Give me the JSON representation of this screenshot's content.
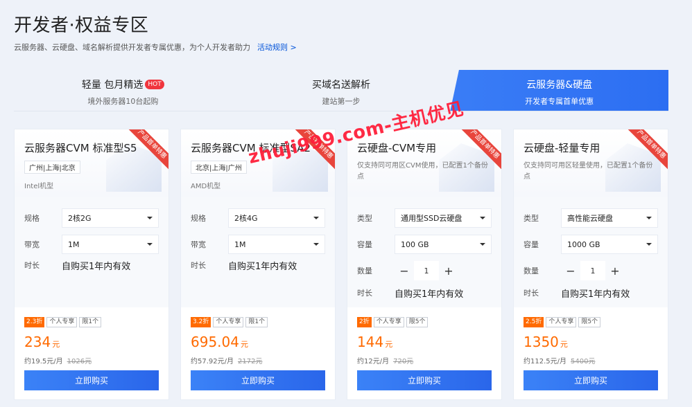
{
  "header": {
    "title": "开发者·权益专区",
    "subtitle": "云服务器、云硬盘、域名解析提供开发者专属优惠，为个人开发者助力",
    "rules_link": "活动规则 >"
  },
  "tabs": [
    {
      "title": "轻量 包月精选",
      "badge": "HOT",
      "sub": "境外服务器10台起购"
    },
    {
      "title": "买域名送解析",
      "sub": "建站第一步"
    },
    {
      "title": "云服务器&硬盘",
      "sub": "开发者专属首单优惠",
      "active": true
    }
  ],
  "ribbon_text": "产品首单特惠",
  "cards": [
    {
      "title": "云服务器CVM 标准型S5",
      "region": "广州|上海|北京",
      "desc": "Intel机型",
      "rows": [
        {
          "label": "规格",
          "value": "2核2G"
        },
        {
          "label": "带宽",
          "value": "1M"
        },
        {
          "label": "时长",
          "value": "自购买1年内有效"
        }
      ],
      "discount": "2.3折",
      "tags": [
        "个人专享",
        "限1个"
      ],
      "price": "234",
      "price_unit": "元",
      "monthly": "约19.5元/月",
      "original": "1026元",
      "buy_label": "立即购买"
    },
    {
      "title": "云服务器CVM 标准型SA2",
      "region": "北京|上海|广州",
      "desc": "AMD机型",
      "rows": [
        {
          "label": "规格",
          "value": "2核4G"
        },
        {
          "label": "带宽",
          "value": "1M"
        },
        {
          "label": "时长",
          "value": "自购买1年内有效"
        }
      ],
      "discount": "3.2折",
      "tags": [
        "个人专享",
        "限1个"
      ],
      "price": "695.04",
      "price_unit": "元",
      "monthly": "约57.92元/月",
      "original": "2172元",
      "buy_label": "立即购买"
    },
    {
      "title": "云硬盘-CVM专用",
      "desc": "仅支持同可用区CVM使用，已配置1个备份点",
      "rows": [
        {
          "label": "类型",
          "value": "通用型SSD云硬盘"
        },
        {
          "label": "容量",
          "value": "100 GB"
        },
        {
          "label": "数量",
          "value": "1"
        },
        {
          "label": "时长",
          "value": "自购买1年内有效"
        }
      ],
      "discount": "2折",
      "tags": [
        "个人专享",
        "限5个"
      ],
      "price": "144",
      "price_unit": "元",
      "monthly": "约12元/月",
      "original": "720元",
      "buy_label": "立即购买"
    },
    {
      "title": "云硬盘-轻量专用",
      "desc": "仅支持同可用区轻量使用，已配置1个备份点",
      "rows": [
        {
          "label": "类型",
          "value": "高性能云硬盘"
        },
        {
          "label": "容量",
          "value": "1000 GB"
        },
        {
          "label": "数量",
          "value": "1"
        },
        {
          "label": "时长",
          "value": "自购买1年内有效"
        }
      ],
      "discount": "2.5折",
      "tags": [
        "个人专享",
        "限5个"
      ],
      "price": "1350",
      "price_unit": "元",
      "monthly": "约112.5元/月",
      "original": "5400元",
      "buy_label": "立即购买"
    }
  ],
  "stepper": {
    "minus": "−",
    "plus": "+"
  },
  "watermark": "zhuji999.com-主机优见",
  "colors": {
    "accent": "#2c6ef2",
    "price": "#ff6a00",
    "hot": "#f0353d",
    "ribbon": "#e8453c"
  }
}
